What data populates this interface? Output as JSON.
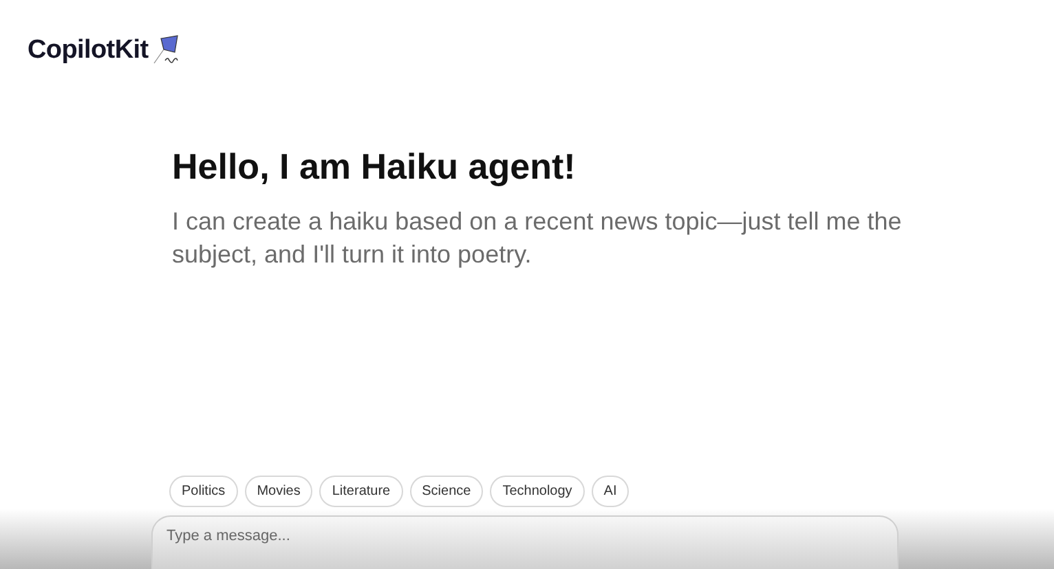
{
  "header": {
    "brand": "CopilotKit"
  },
  "intro": {
    "title": "Hello, I am Haiku agent!",
    "text": "I can create a haiku based on a recent news topic—just tell me the subject, and I'll turn it into poetry."
  },
  "suggestions": [
    {
      "label": "Politics"
    },
    {
      "label": "Movies"
    },
    {
      "label": "Literature"
    },
    {
      "label": "Science"
    },
    {
      "label": "Technology"
    },
    {
      "label": "AI"
    }
  ],
  "composer": {
    "placeholder": "Type a message..."
  }
}
